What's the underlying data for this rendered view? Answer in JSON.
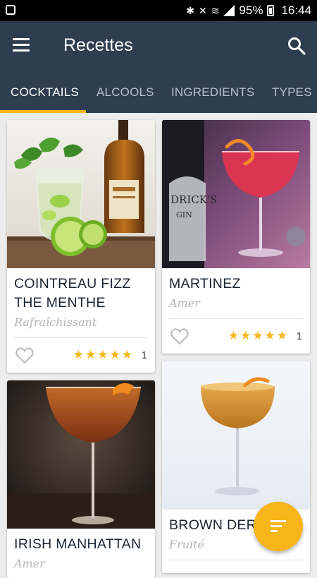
{
  "status_bar": {
    "battery": "95%",
    "time": "16:44",
    "icons": [
      "gallery-icon",
      "bluetooth-icon",
      "mute-icon",
      "wifi-icon",
      "signal-icon",
      "battery-icon"
    ]
  },
  "app_bar": {
    "title": "Recettes",
    "menu_icon": "hamburger-menu-icon",
    "search_icon": "search-icon"
  },
  "tabs": [
    {
      "label": "COCKTAILS",
      "active": true
    },
    {
      "label": "ALCOOLS",
      "active": false
    },
    {
      "label": "INGREDIENTS",
      "active": false
    },
    {
      "label": "TYPES",
      "active": false
    }
  ],
  "colors": {
    "app_bar": "#2e3d50",
    "accent": "#f7b519",
    "background": "#ececec"
  },
  "cards": [
    {
      "title_line1": "COINTREAU FIZZ",
      "title_line2": "THE MENTHE",
      "subtitle": "Rafraîchissant",
      "rating": 5,
      "count": "1",
      "stars": "★★★★★"
    },
    {
      "title_line1": "MARTINEZ",
      "subtitle": "Amer",
      "rating": 5,
      "count": "1",
      "stars": "★★★★★"
    },
    {
      "title_line1": "IRISH MANHATTAN",
      "subtitle": "Amer"
    },
    {
      "title_line1": "BROWN DER",
      "subtitle": "Fruité"
    }
  ],
  "fab": {
    "icon": "sort-filter-icon"
  }
}
